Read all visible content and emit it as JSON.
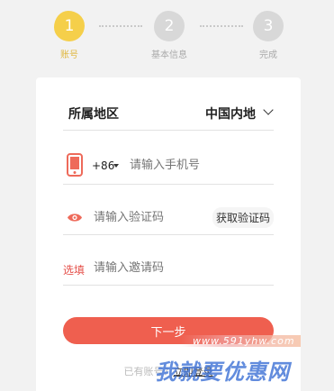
{
  "steps": [
    {
      "number": "1",
      "label": "账号"
    },
    {
      "number": "2",
      "label": "基本信息"
    },
    {
      "number": "3",
      "label": "完成"
    }
  ],
  "form": {
    "region_label": "所属地区",
    "region_value": "中国内地",
    "country_code": "+86",
    "phone_placeholder": "请输入手机号",
    "code_placeholder": "请输入验证码",
    "get_code_label": "获取验证码",
    "invite_tag": "选填",
    "invite_placeholder": "请输入邀请码",
    "next_label": "下一步",
    "login_prefix": "已有账号？",
    "login_link": "立即登录"
  },
  "watermark": {
    "url": "www.591yhw.com",
    "text": "我就要优惠网"
  },
  "colors": {
    "active_step": "#f5cf4a",
    "inactive_step": "#d8d8d8",
    "accent": "#ef5f4f"
  },
  "icons": [
    "phone-icon",
    "eye-icon",
    "chevron-down-icon"
  ]
}
